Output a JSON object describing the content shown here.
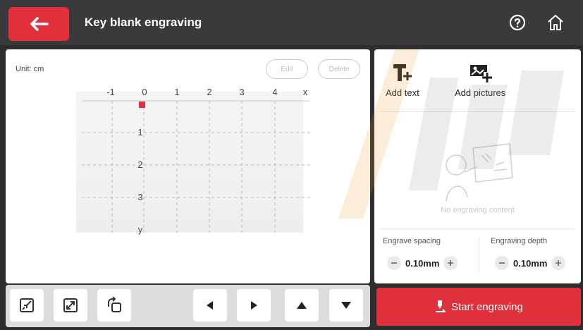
{
  "header": {
    "title": "Key blank engraving",
    "back_icon": "arrow-left-icon",
    "help_icon": "help-circle-icon",
    "home_icon": "home-icon"
  },
  "canvas": {
    "unit_label": "Unit: cm",
    "edit_label": "Edit",
    "delete_label": "Delete",
    "x_ticks": [
      "-1",
      "0",
      "1",
      "2",
      "3",
      "4",
      "x"
    ],
    "y_ticks": [
      "1",
      "2",
      "3",
      "y"
    ]
  },
  "toolbar": {
    "buttons": [
      "shrink-icon",
      "expand-icon",
      "rotate-icon",
      "arrow-left-icon",
      "arrow-right-icon",
      "arrow-up-icon",
      "arrow-down-icon"
    ]
  },
  "right_panel": {
    "add_text_label": "Add text",
    "add_pictures_label": "Add pictures",
    "empty_text": "No engraving content",
    "spacing_label": "Engrave spacing",
    "spacing_value": "0.10mm",
    "depth_label": "Engraving depth",
    "depth_value": "0.10mm"
  },
  "start_label": "Start engraving",
  "colors": {
    "accent": "#e0303b",
    "header_bg": "#3a3a3c",
    "marker": "#e0303b"
  }
}
